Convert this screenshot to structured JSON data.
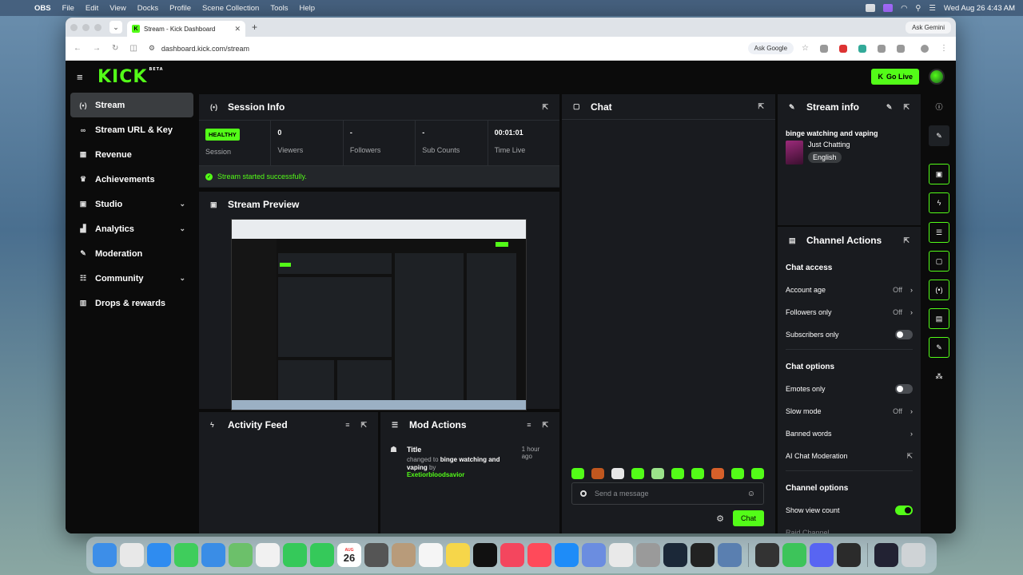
{
  "menubar": {
    "app": "OBS",
    "items": [
      "File",
      "Edit",
      "View",
      "Docks",
      "Profile",
      "Scene Collection",
      "Tools",
      "Help"
    ],
    "datetime": "Wed Aug 26  4:43 AM"
  },
  "browser": {
    "tab_title": "Stream - Kick Dashboard",
    "url": "dashboard.kick.com/stream",
    "ask_google": "Ask Google",
    "ask_gemini": "Ask Gemini"
  },
  "header": {
    "logo": "KICK",
    "beta": "BETA",
    "go_live": "Go Live"
  },
  "sidebar": {
    "items": [
      {
        "label": "Stream",
        "icon": "broadcast-icon",
        "glyph": "(•)",
        "active": true,
        "expandable": false
      },
      {
        "label": "Stream URL & Key",
        "icon": "link-icon",
        "glyph": "∞",
        "active": false,
        "expandable": false
      },
      {
        "label": "Revenue",
        "icon": "chart-icon",
        "glyph": "▦",
        "active": false,
        "expandable": false
      },
      {
        "label": "Achievements",
        "icon": "trophy-icon",
        "glyph": "♛",
        "active": false,
        "expandable": false
      },
      {
        "label": "Studio",
        "icon": "studio-icon",
        "glyph": "▣",
        "active": false,
        "expandable": true
      },
      {
        "label": "Analytics",
        "icon": "analytics-icon",
        "glyph": "▟",
        "active": false,
        "expandable": true
      },
      {
        "label": "Moderation",
        "icon": "wrench-icon",
        "glyph": "✎",
        "active": false,
        "expandable": false
      },
      {
        "label": "Community",
        "icon": "community-icon",
        "glyph": "☷",
        "active": false,
        "expandable": true
      },
      {
        "label": "Drops & rewards",
        "icon": "gift-icon",
        "glyph": "▥",
        "active": false,
        "expandable": false
      }
    ]
  },
  "session_info": {
    "title": "Session Info",
    "healthy": "HEALTHY",
    "session_label": "Session",
    "stats": [
      {
        "value": "0",
        "label": "Viewers"
      },
      {
        "value": "-",
        "label": "Followers"
      },
      {
        "value": "-",
        "label": "Sub Counts"
      },
      {
        "value": "00:01:01",
        "label": "Time Live"
      }
    ],
    "message": "Stream started successfully."
  },
  "stream_preview": {
    "title": "Stream Preview"
  },
  "activity_feed": {
    "title": "Activity Feed"
  },
  "mod_actions": {
    "title": "Mod Actions",
    "entry": {
      "title": "Title",
      "time": "1 hour ago",
      "prefix": "changed to",
      "value": "binge watching and vaping",
      "by": "by",
      "user": "Exetiorbloodsavior"
    }
  },
  "chat": {
    "title": "Chat",
    "placeholder": "Send a message",
    "send": "Chat"
  },
  "stream_info": {
    "title": "Stream info",
    "stream_title": "binge watching and vaping",
    "category": "Just Chatting",
    "tag": "English"
  },
  "channel_actions": {
    "title": "Channel Actions",
    "chat_access": "Chat access",
    "account_age": {
      "label": "Account age",
      "value": "Off"
    },
    "followers_only": {
      "label": "Followers only",
      "value": "Off"
    },
    "subscribers_only": {
      "label": "Subscribers only",
      "on": false
    },
    "chat_options": "Chat options",
    "emotes_only": {
      "label": "Emotes only",
      "on": false
    },
    "slow_mode": {
      "label": "Slow mode",
      "value": "Off"
    },
    "banned_words": "Banned words",
    "ai_moderation": "AI Chat Moderation",
    "channel_options": "Channel options",
    "show_view_count": {
      "label": "Show view count",
      "on": true
    },
    "raid_channel": "Raid Channel"
  },
  "colors": {
    "accent": "#53fc18",
    "panel": "#191b1f",
    "background": "#0b0b0b"
  },
  "dock": {
    "calendar_month": "AUG",
    "calendar_day": "26"
  }
}
